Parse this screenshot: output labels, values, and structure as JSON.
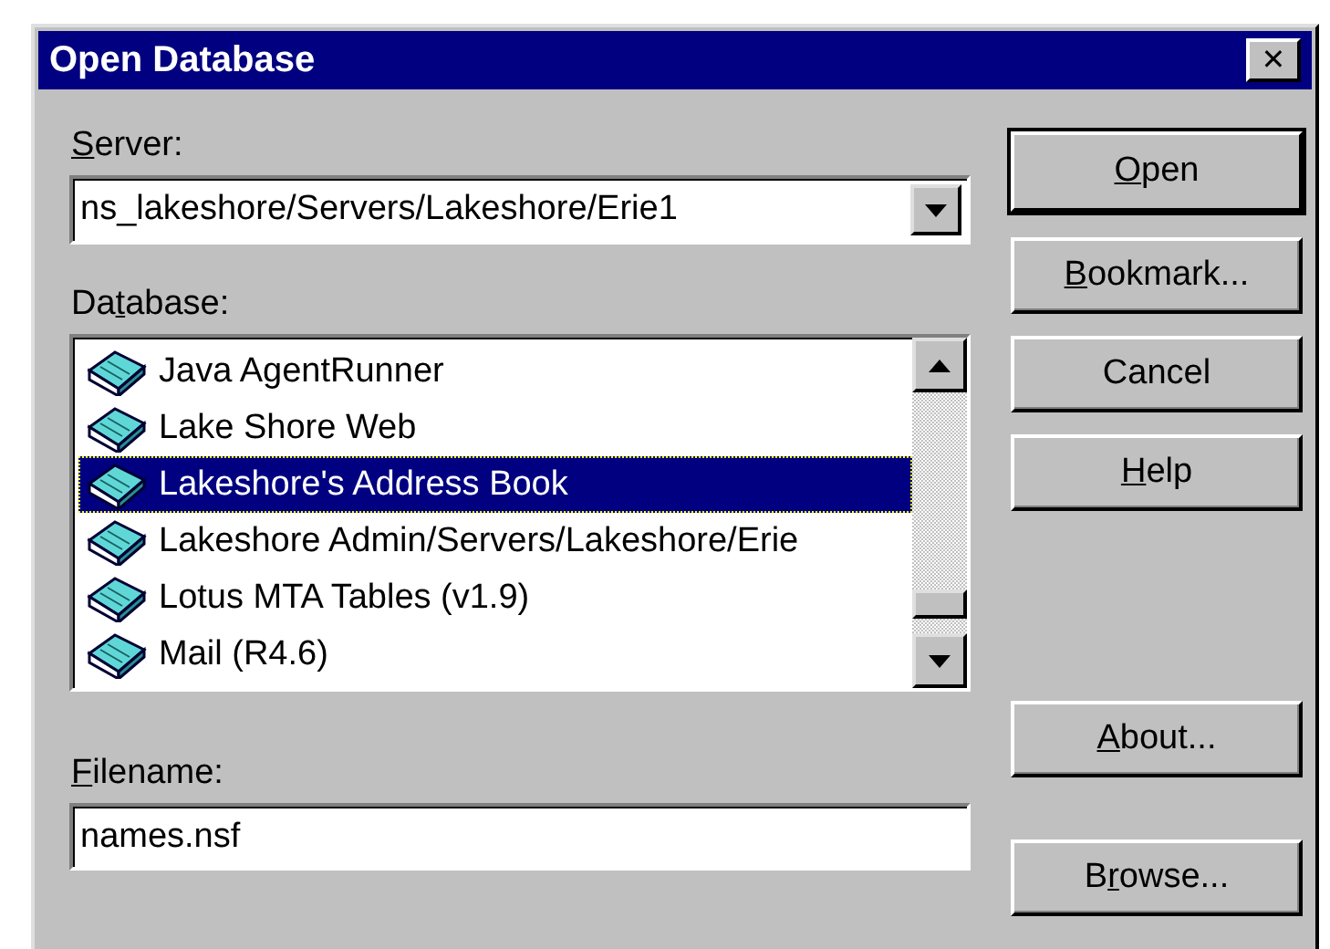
{
  "window": {
    "title": "Open Database",
    "close_glyph": "✕"
  },
  "server": {
    "label": {
      "key": "S",
      "after": "erver:"
    },
    "value": "ns_lakeshore/Servers/Lakeshore/Erie1"
  },
  "database": {
    "label": {
      "before": "Da",
      "key": "t",
      "after": "abase:"
    },
    "items": [
      {
        "name": "Java AgentRunner",
        "selected": false
      },
      {
        "name": "Lake Shore Web",
        "selected": false
      },
      {
        "name": "Lakeshore's Address Book",
        "selected": true
      },
      {
        "name": "Lakeshore Admin/Servers/Lakeshore/Erie",
        "selected": false
      },
      {
        "name": "Lotus MTA Tables (v1.9)",
        "selected": false
      },
      {
        "name": "Mail (R4.6)",
        "selected": false
      }
    ]
  },
  "filename": {
    "label": {
      "key": "F",
      "after": "ilename:"
    },
    "value": "names.nsf"
  },
  "buttons": [
    {
      "label": {
        "key": "O",
        "after": "pen"
      },
      "default": true
    },
    {
      "label": {
        "key": "B",
        "after": "ookmark..."
      },
      "default": false
    },
    {
      "label": {
        "before": "Cancel"
      },
      "default": false
    },
    {
      "label": {
        "key": "H",
        "after": "elp"
      },
      "default": false
    }
  ],
  "about_button": {
    "label": {
      "key": "A",
      "after": "bout..."
    }
  },
  "browse_button": {
    "label": {
      "before": "B",
      "key": "r",
      "after": "owse..."
    }
  }
}
